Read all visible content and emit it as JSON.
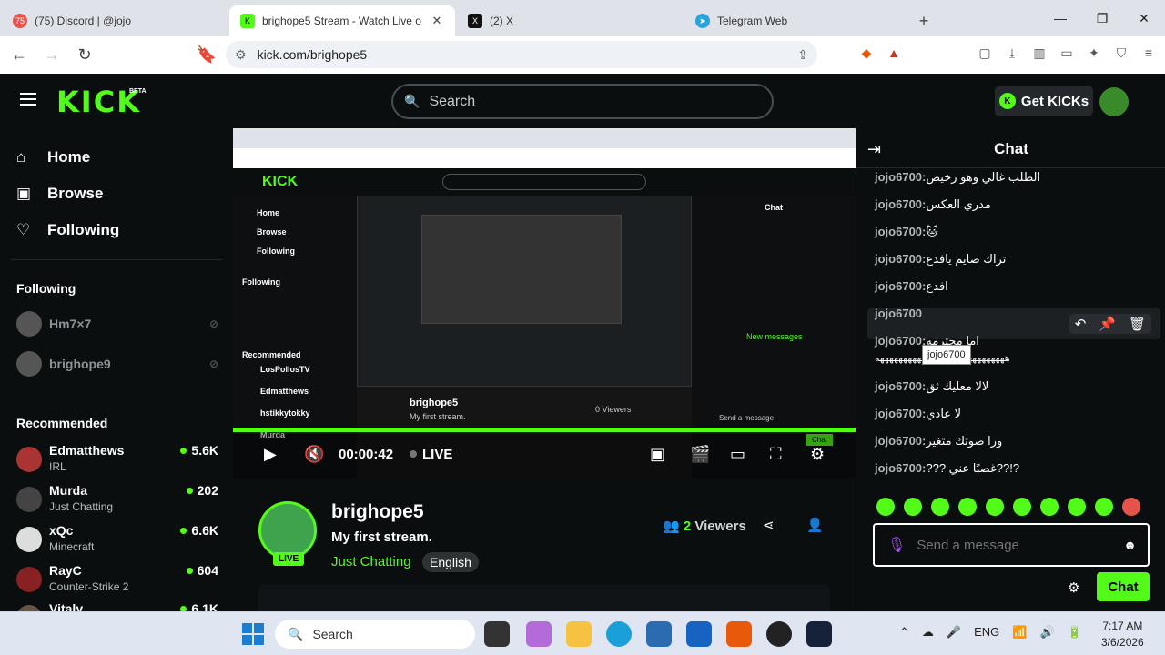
{
  "browser": {
    "tabs": [
      {
        "title": "(75) Discord | @jojo",
        "badge": "75",
        "color": "#e5534b"
      },
      {
        "title": "brighope5 Stream - Watch Live o",
        "badge": "K",
        "color": "#53fc18"
      },
      {
        "title": "(2) X",
        "badge": "X",
        "color": "#111111"
      },
      {
        "title": "Telegram Web",
        "badge": "➤",
        "color": "#2aa3df"
      }
    ],
    "url": "kick.com/brighope5"
  },
  "header": {
    "logo": "KICK",
    "beta": "BETA",
    "search_placeholder": "Search",
    "get_kicks": "Get KICKs"
  },
  "sidebar": {
    "nav": [
      {
        "label": "Home",
        "icon": "⌂"
      },
      {
        "label": "Browse",
        "icon": "▣"
      },
      {
        "label": "Following",
        "icon": "♡"
      }
    ],
    "following_title": "Following",
    "following": [
      {
        "name": "Hm7×7"
      },
      {
        "name": "brighope9"
      }
    ],
    "recommended_title": "Recommended",
    "recommended": [
      {
        "name": "Edmatthews",
        "category": "IRL",
        "viewers": "5.6K",
        "color": "#a33"
      },
      {
        "name": "Murda",
        "category": "Just Chatting",
        "viewers": "202",
        "color": "#444"
      },
      {
        "name": "xQc",
        "category": "Minecraft",
        "viewers": "6.6K",
        "color": "#ddd"
      },
      {
        "name": "RayC",
        "category": "Counter-Strike 2",
        "viewers": "604",
        "color": "#822"
      },
      {
        "name": "Vitaly",
        "category": "",
        "viewers": "6.1K",
        "color": "#654"
      }
    ]
  },
  "player": {
    "time": "00:00:42",
    "live": "LIVE"
  },
  "stream": {
    "name": "brighope5",
    "title": "My first stream.",
    "category": "Just Chatting",
    "language": "English",
    "viewers_count": "2",
    "viewers_label": "Viewers",
    "live_badge": "LIVE"
  },
  "nested": {
    "stream_name": "brighope5",
    "stream_title": "My first stream.",
    "viewers": "0 Viewers",
    "chat_title": "Chat",
    "send_placeholder": "Send a message",
    "chat_button": "Chat",
    "new_messages": "New messages",
    "lines": [
      "Home",
      "Browse",
      "Following",
      "Following",
      "Recommended",
      "LosPollosTV",
      "Edmatthews",
      "hstikkytokky",
      "Murda"
    ]
  },
  "chat": {
    "title": "Chat",
    "messages": [
      {
        "user": "jojo6700:",
        "text": "الطلب غالي وهو رخيص"
      },
      {
        "user": "jojo6700:",
        "text": "مدري العكس"
      },
      {
        "user": "jojo6700:",
        "text": "🐱"
      },
      {
        "user": "jojo6700:",
        "text": "تراك صايم يافدع"
      },
      {
        "user": "jojo6700:",
        "text": "افدع"
      },
      {
        "user": "jojo6700",
        "text": ""
      },
      {
        "user": "jojo6700:",
        "text": "اما محترمه"
      },
      {
        "user": "",
        "text": "ههههههههههههههههههههههههههههه"
      },
      {
        "user": "jojo6700:",
        "text": "لالا معليك ثق"
      },
      {
        "user": "jojo6700:",
        "text": "لا عادي"
      },
      {
        "user": "jojo6700:",
        "text": "ورا صوتك متغير"
      },
      {
        "user": "jojo6700:",
        "text": "??? غصبًا عني??!?"
      }
    ],
    "tooltip": "jojo6700",
    "send_placeholder": "Send a message",
    "chat_button": "Chat"
  },
  "taskbar": {
    "search": "Search",
    "lang": "ENG",
    "time": "7:17 AM",
    "date": "3/6/2026"
  }
}
